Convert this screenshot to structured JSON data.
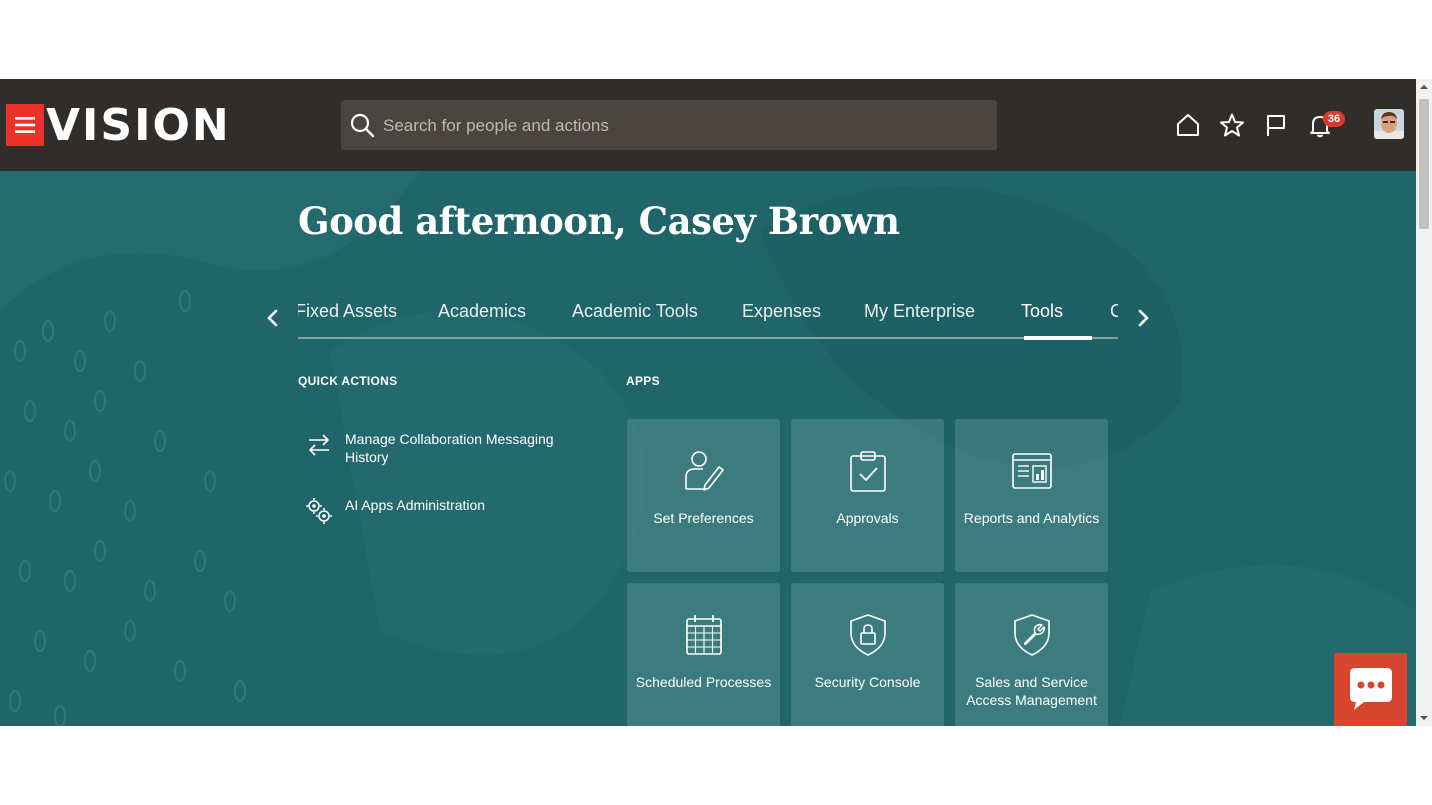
{
  "header": {
    "logo": "VISION",
    "search_placeholder": "Search for people and actions",
    "notification_count": "36",
    "icons": [
      "home-icon",
      "favorites-star-icon",
      "watchlist-flag-icon",
      "notifications-bell-icon"
    ]
  },
  "greeting": "Good afternoon, Casey Brown",
  "tabs": [
    {
      "label": "Fixed Assets",
      "active": false
    },
    {
      "label": "Academics",
      "active": false
    },
    {
      "label": "Academic Tools",
      "active": false
    },
    {
      "label": "Expenses",
      "active": false
    },
    {
      "label": "My Enterprise",
      "active": false
    },
    {
      "label": "Tools",
      "active": true
    },
    {
      "label": "C",
      "active": false
    }
  ],
  "quick_actions": {
    "title": "QUICK ACTIONS",
    "items": [
      {
        "label": "Manage Collaboration Messaging History",
        "icon": "exchange-arrows-icon"
      },
      {
        "label": "AI Apps Administration",
        "icon": "gears-icon"
      }
    ]
  },
  "apps": {
    "title": "APPS",
    "tiles": [
      {
        "label": "Set Preferences",
        "icon": "person-edit-icon"
      },
      {
        "label": "Approvals",
        "icon": "clipboard-check-icon"
      },
      {
        "label": "Reports and Analytics",
        "icon": "report-chart-icon"
      },
      {
        "label": "Scheduled Processes",
        "icon": "calendar-icon"
      },
      {
        "label": "Security Console",
        "icon": "shield-lock-icon"
      },
      {
        "label": "Sales and Service Access Management",
        "icon": "shield-wrench-icon"
      }
    ]
  },
  "colors": {
    "header_bg": "#312d2a",
    "main_bg": "#1f6569",
    "accent_red": "#e8322a",
    "chat_button": "#d6452e"
  }
}
